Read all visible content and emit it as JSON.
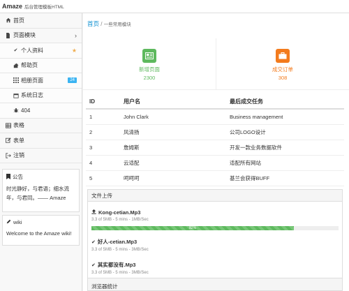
{
  "header": {
    "brand": "Amaze",
    "subtitle": "后台管理模板HTML"
  },
  "sidebar": {
    "items": [
      {
        "label": "首页",
        "icon": "home-icon"
      },
      {
        "label": "页面模块",
        "icon": "file-icon"
      },
      {
        "label": "个人资料",
        "icon": "check-icon",
        "sub": true
      },
      {
        "label": "帮助页",
        "icon": "puzzle-icon",
        "sub": true
      },
      {
        "label": "相册页面",
        "icon": "grid-icon",
        "sub": true,
        "badge": "24"
      },
      {
        "label": "系统日志",
        "icon": "calendar-icon",
        "sub": true
      },
      {
        "label": "404",
        "icon": "bug-icon",
        "sub": true
      },
      {
        "label": "表格",
        "icon": "table-icon"
      },
      {
        "label": "表单",
        "icon": "pencil-icon"
      },
      {
        "label": "注销",
        "icon": "sign-out-icon"
      }
    ],
    "notice": {
      "title": "公告",
      "body": "时光静好，与君语；细水流年，与君同。—— Amaze"
    },
    "wiki": {
      "title": "wiki",
      "body": "Welcome to the Amaze wiki!"
    }
  },
  "breadcrumb": {
    "home": "首页",
    "sep": "/",
    "current": "一些常用模块"
  },
  "stats": [
    {
      "title": "新增页面",
      "value": "2300",
      "color": "#5eb95e",
      "icon": "newspaper-icon"
    },
    {
      "title": "成交订单",
      "value": "308",
      "color": "#f37b1d",
      "icon": "briefcase-icon"
    }
  ],
  "table": {
    "headers": [
      "ID",
      "用户名",
      "最后成交任务"
    ],
    "rows": [
      [
        "1",
        "John Clark",
        "Business management"
      ],
      [
        "2",
        "风清扬",
        "公司LOGO设计"
      ],
      [
        "3",
        "詹姆斯",
        "开发一款业务数据软件"
      ],
      [
        "4",
        "云适配",
        "适配所有网站"
      ],
      [
        "5",
        "呵呵呵",
        "基兰会获得BUFF"
      ]
    ]
  },
  "upload": {
    "title": "文件上传",
    "progress_label": "82%",
    "progress_value": 82,
    "files": [
      {
        "name": "Kong-cetian.Mp3",
        "meta": "3.3 of 5MB - 5 mins - 1MB/Sec",
        "icon": "upload-icon"
      },
      {
        "name": "好人-cetian.Mp3",
        "meta": "3.3 of 5MB - 5 mins - 3MB/Sec",
        "icon": "check-icon"
      },
      {
        "name": "其实都没有.Mp3",
        "meta": "3.3 of 5MB - 5 mins - 3MB/Sec",
        "icon": "check-icon"
      }
    ]
  },
  "browser": {
    "title": "浏览器统计"
  }
}
